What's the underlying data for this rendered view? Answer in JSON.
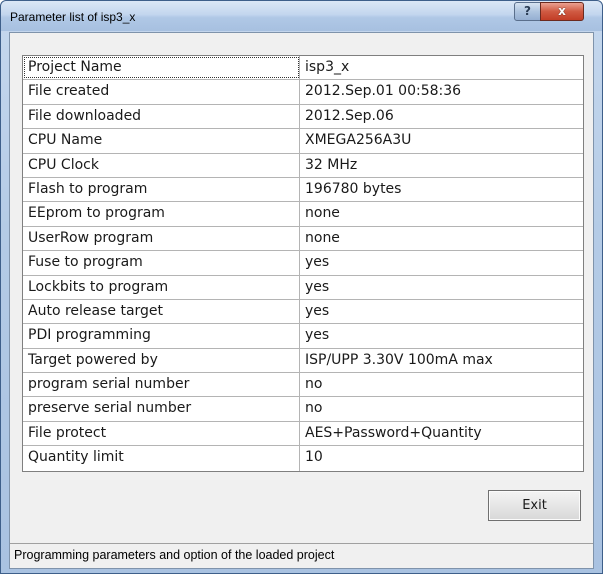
{
  "window": {
    "title": "Parameter list of isp3_x",
    "help_glyph": "?",
    "close_glyph": "x"
  },
  "parameters": [
    {
      "name": "Project Name",
      "value": "isp3_x"
    },
    {
      "name": "File created",
      "value": "2012.Sep.01 00:58:36"
    },
    {
      "name": "File downloaded",
      "value": "2012.Sep.06"
    },
    {
      "name": "CPU Name",
      "value": "XMEGA256A3U"
    },
    {
      "name": "CPU Clock",
      "value": "32 MHz"
    },
    {
      "name": "Flash to program",
      "value": "196780 bytes"
    },
    {
      "name": "EEprom to program",
      "value": "none"
    },
    {
      "name": "UserRow program",
      "value": "none"
    },
    {
      "name": "Fuse to program",
      "value": "yes"
    },
    {
      "name": "Lockbits to program",
      "value": "yes"
    },
    {
      "name": "Auto release target",
      "value": "yes"
    },
    {
      "name": "PDI programming",
      "value": "yes"
    },
    {
      "name": "Target powered by",
      "value": "ISP/UPP 3.30V 100mA max"
    },
    {
      "name": "program serial number",
      "value": "no"
    },
    {
      "name": "preserve serial number",
      "value": "no"
    },
    {
      "name": "File protect",
      "value": "AES+Password+Quantity"
    },
    {
      "name": "Quantity limit",
      "value": "10"
    }
  ],
  "buttons": {
    "exit_label": "Exit"
  },
  "statusbar": {
    "text": "Programming parameters and option of the loaded project"
  },
  "colors": {
    "close_button": "#c94a33",
    "title_bar": "#b9cfea"
  }
}
